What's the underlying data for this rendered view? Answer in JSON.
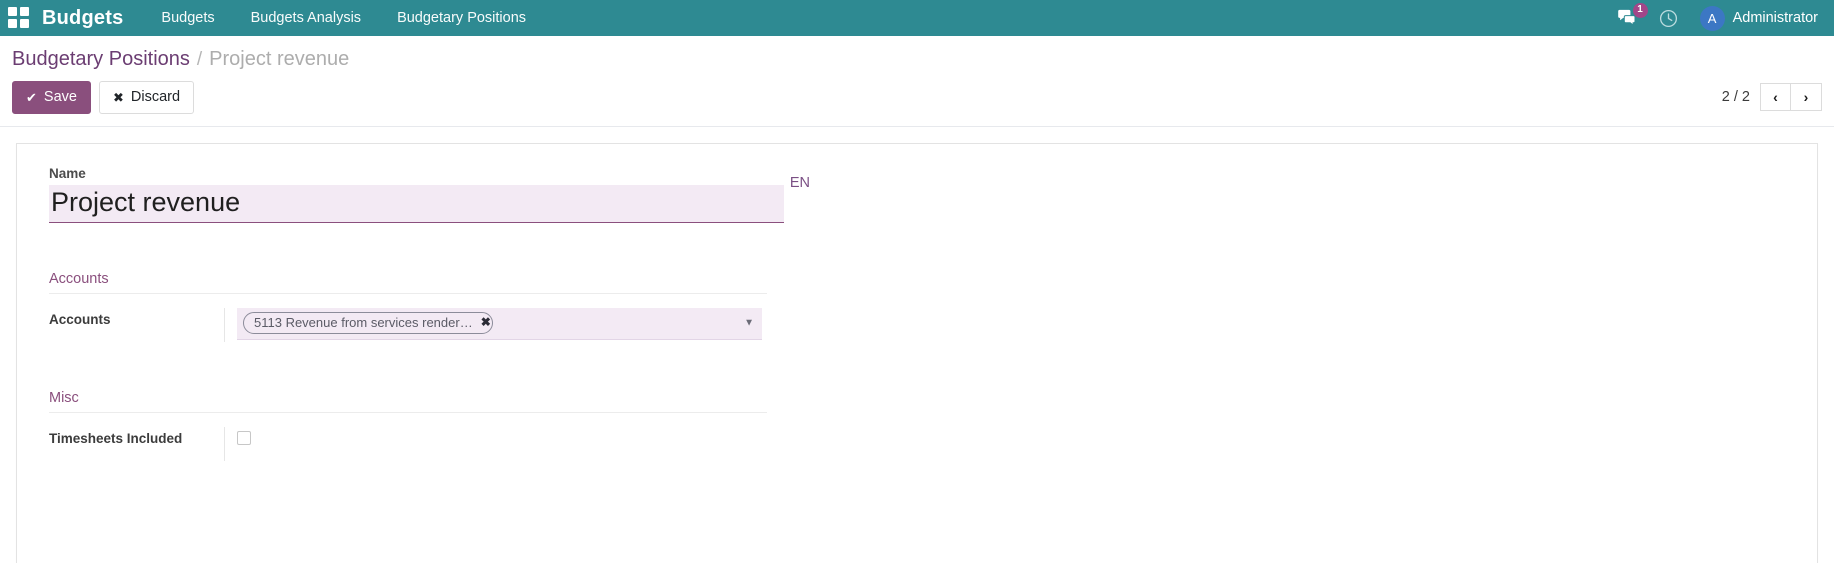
{
  "navbar": {
    "apps_icon": "apps-grid-icon",
    "brand": "Budgets",
    "menu": [
      {
        "label": "Budgets"
      },
      {
        "label": "Budgets Analysis"
      },
      {
        "label": "Budgetary Positions"
      }
    ],
    "messages_icon": "messages-icon",
    "messages_count": "1",
    "activities_icon": "clock-icon",
    "avatar_initial": "A",
    "user_name": "Administrator",
    "bg_color": "#2e8a92",
    "badge_color": "#a24689",
    "avatar_color": "#3c77c4"
  },
  "breadcrumb": {
    "root": "Budgetary Positions",
    "separator": "/",
    "current": "Project revenue"
  },
  "controls": {
    "save_label": "Save",
    "save_icon": "check-icon",
    "discard_label": "Discard",
    "discard_icon": "x-icon",
    "save_color": "#8a4f7d"
  },
  "pager": {
    "count": "2 / 2",
    "prev_icon": "chevron-left-icon",
    "prev_label": "‹",
    "next_icon": "chevron-right-icon",
    "next_label": "›"
  },
  "form": {
    "name_label": "Name",
    "name_value": "Project revenue",
    "name_placeholder": "e.g. Sales",
    "lang_badge": "EN",
    "groups": [
      {
        "title": "Accounts",
        "fields": [
          {
            "label": "Accounts",
            "type": "many2many_tags",
            "tags": [
              "5113 Revenue from services render…"
            ],
            "tag_remove_icon": "close-icon",
            "dropdown_icon": "caret-down-icon"
          }
        ]
      },
      {
        "title": "Misc",
        "fields": [
          {
            "label": "Timesheets Included",
            "type": "checkbox",
            "checked": false
          }
        ]
      }
    ]
  }
}
